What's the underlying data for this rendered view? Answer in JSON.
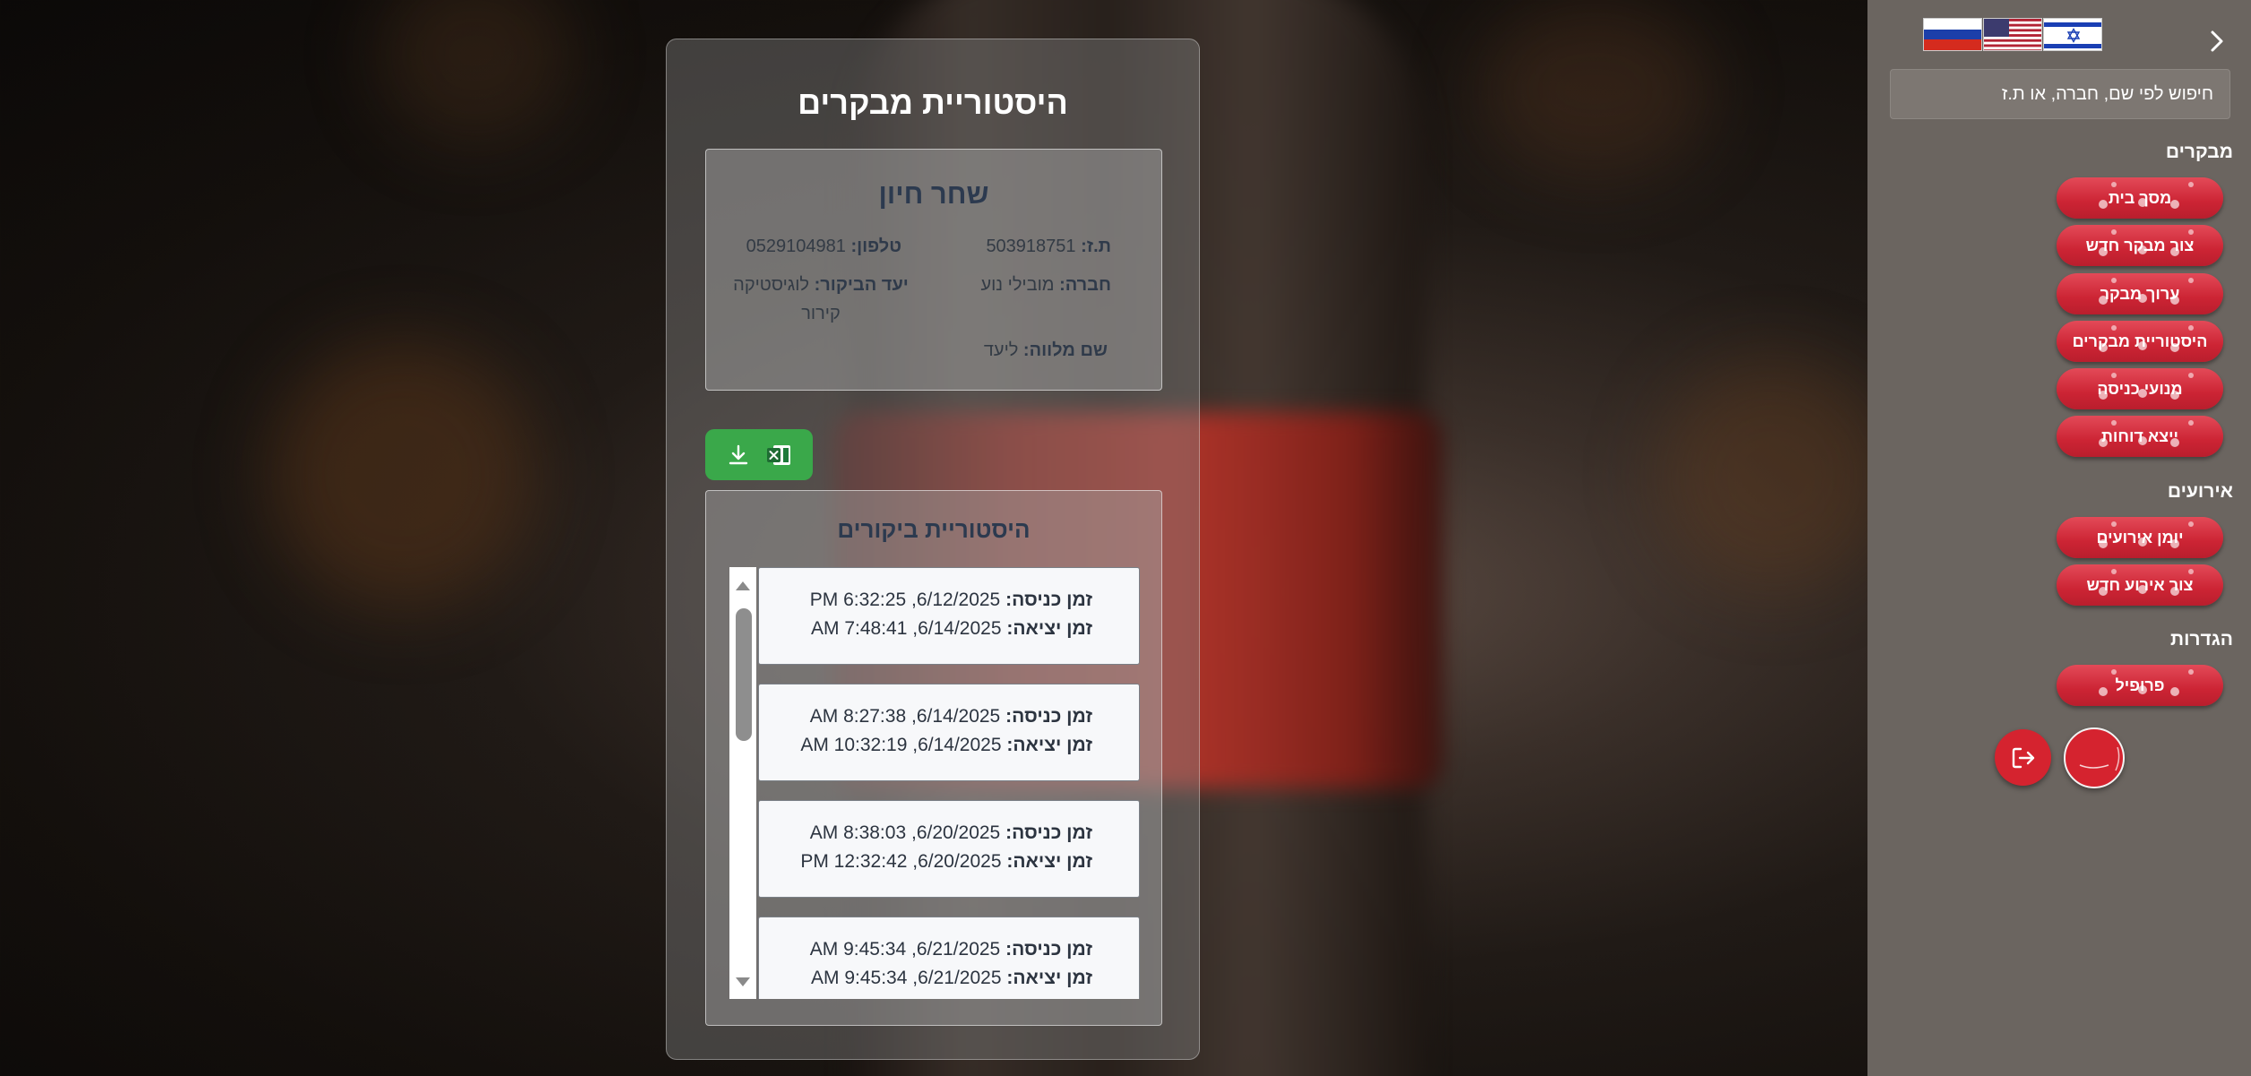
{
  "page": {
    "title": "היסטוריית מבקרים"
  },
  "visitor": {
    "name": "שחר חיון",
    "id_label": "ת.ז:",
    "id_value": "503918751",
    "phone_label": "טלפון:",
    "phone_value": "0529104981",
    "company_label": "חברה:",
    "company_value": "מובילי נוע",
    "purpose_label": "יעד הביקור:",
    "purpose_value": "לוגיסטיקה קירור",
    "escort_label": "שם מלווה:",
    "escort_value": "ליעד"
  },
  "export": {
    "download_icon": "download-icon",
    "excel_icon": "excel-icon",
    "accent": "#3aa84a"
  },
  "history": {
    "title": "היסטוריית ביקורים",
    "entry_label": "זמן כניסה:",
    "exit_label": "זמן יציאה:",
    "visits": [
      {
        "entry": "6/12/2025, 6:32:25 PM",
        "exit": "6/14/2025, 7:48:41 AM"
      },
      {
        "entry": "6/14/2025, 8:27:38 AM",
        "exit": "6/14/2025, 10:32:19 AM"
      },
      {
        "entry": "6/20/2025, 8:38:03 AM",
        "exit": "6/20/2025, 12:32:42 PM"
      },
      {
        "entry": "6/21/2025, 9:45:34 AM",
        "exit": "6/21/2025, 9:45:34 AM"
      }
    ]
  },
  "sidebar": {
    "search_placeholder": "חיפוש לפי שם, חברה, או ת.ז",
    "languages": [
      "russian-flag-icon",
      "us-flag-icon",
      "israel-flag-icon"
    ],
    "collapse_icon": "chevron-right-icon",
    "sections": {
      "visitors": "מבקרים",
      "events": "אירועים",
      "settings": "הגדרות"
    },
    "visitor_items": [
      "מסך בית",
      "צור מבקר חדש",
      "ערוך מבקר",
      "היסטוריית מבקרים",
      "מנועי כניסה",
      "ייצא דוחות"
    ],
    "event_items": [
      "יומן אירועים",
      "צור אירוע חדש"
    ],
    "settings_items": [
      "פרופיל"
    ],
    "accent": "#d5232f"
  }
}
